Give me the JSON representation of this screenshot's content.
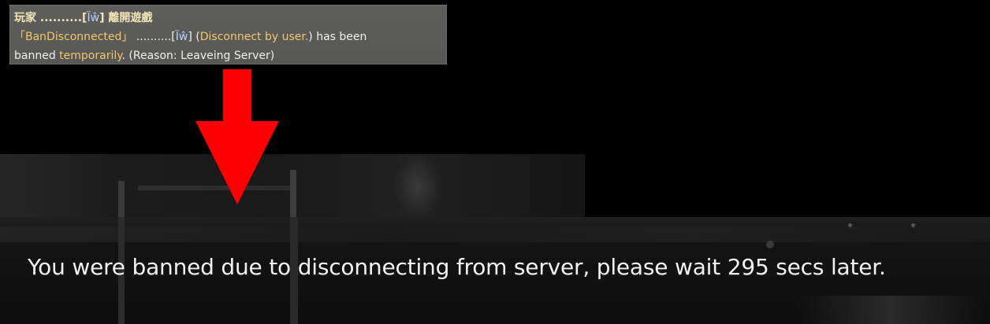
{
  "chat_log": {
    "line1": {
      "prefix": "玩家 ..........[",
      "tag": "Ïŵ",
      "suffix": "] 離開遊戲"
    },
    "line2": {
      "open_bracket": "「",
      "ban_label": "BanDisconnected",
      "close_bracket": "」",
      "dots": " ..........[",
      "tag": "Ïŵ",
      "bracket_close": "] (",
      "reason_in": "Disconnect by user.",
      "paren_close": ") has been"
    },
    "line3": {
      "banned": "banned ",
      "temporarily": "temporarily",
      "reason": ". (Reason: Leaveing Server)"
    }
  },
  "message": {
    "ban_text": "You were banned due to disconnecting from server, please wait 295 secs later."
  },
  "colors": {
    "arrow": "#ff0000",
    "highlight": "#f4c76a",
    "player_tag": "#b8d3ff"
  },
  "icons": {
    "pointer": "down-arrow-icon"
  }
}
